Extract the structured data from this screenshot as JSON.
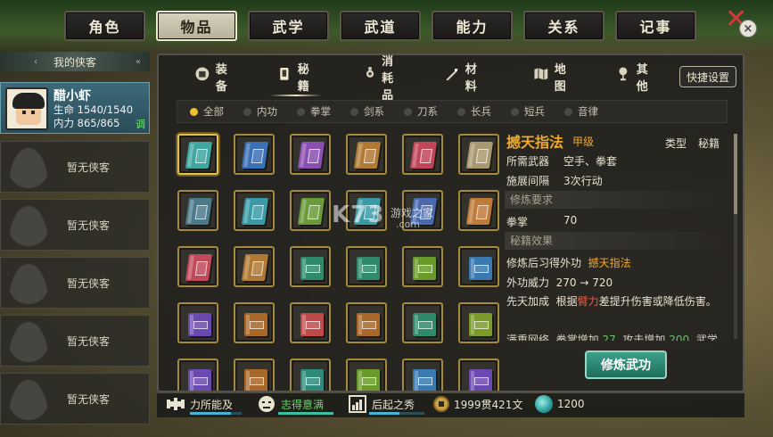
{
  "top_tabs": [
    {
      "label": "角色",
      "active": false
    },
    {
      "label": "物品",
      "active": true
    },
    {
      "label": "武学",
      "active": false
    },
    {
      "label": "武道",
      "active": false
    },
    {
      "label": "能力",
      "active": false
    },
    {
      "label": "关系",
      "active": false
    },
    {
      "label": "记事",
      "active": false
    }
  ],
  "close_icon": "close-icon",
  "roster": {
    "title": "我的侠客",
    "hero": {
      "name": "醋小虾",
      "hp_label": "生命",
      "hp_value": "1540/1540",
      "mp_label": "内力",
      "mp_value": "865/865",
      "tune_label": "调"
    },
    "empty_label": "暂无侠客",
    "empty_slots": 5
  },
  "sub_tabs": [
    {
      "label": "装备",
      "icon": "armor-icon",
      "active": false
    },
    {
      "label": "秘籍",
      "icon": "scroll-icon",
      "active": true
    },
    {
      "label": "消耗品",
      "icon": "potion-icon",
      "active": false
    },
    {
      "label": "材料",
      "icon": "sword-material-icon",
      "active": false
    },
    {
      "label": "地图",
      "icon": "map-icon",
      "active": false
    },
    {
      "label": "其他",
      "icon": "lantern-icon",
      "active": false
    }
  ],
  "quick_settings": "快捷设置",
  "filters": [
    {
      "label": "全部",
      "active": true
    },
    {
      "label": "内功",
      "active": false
    },
    {
      "label": "拳掌",
      "active": false
    },
    {
      "label": "剑系",
      "active": false
    },
    {
      "label": "刀系",
      "active": false
    },
    {
      "label": "长兵",
      "active": false
    },
    {
      "label": "短兵",
      "active": false
    },
    {
      "label": "音律",
      "active": false
    }
  ],
  "books": [
    {
      "color": "#3fa6a0",
      "style": "tilt"
    },
    {
      "color": "#3b6fb6",
      "style": "tilt"
    },
    {
      "color": "#8a4fb0",
      "style": "tilt"
    },
    {
      "color": "#b07a34",
      "style": "tilt"
    },
    {
      "color": "#c0465a",
      "style": "tilt"
    },
    {
      "color": "#a89a70",
      "style": "tilt"
    },
    {
      "color": "#4a7a8a",
      "style": "tilt"
    },
    {
      "color": "#3a9aa6",
      "style": "tilt"
    },
    {
      "color": "#6a9a3a",
      "style": "tilt"
    },
    {
      "color": "#3a9aa6",
      "style": "tilt"
    },
    {
      "color": "#4a6ab0",
      "style": "tilt"
    },
    {
      "color": "#c07a3a",
      "style": "tilt"
    },
    {
      "color": "#c04a5a",
      "style": "tilt"
    },
    {
      "color": "#b07a34",
      "style": "tilt"
    },
    {
      "color": "#2e8a6a",
      "style": "flat"
    },
    {
      "color": "#2e8a6a",
      "style": "flat"
    },
    {
      "color": "#6a9a2a",
      "style": "flat"
    },
    {
      "color": "#3a7ab0",
      "style": "flat"
    },
    {
      "color": "#6a4ab0",
      "style": "flat"
    },
    {
      "color": "#a8682a",
      "style": "flat"
    },
    {
      "color": "#c04a4a",
      "style": "flat"
    },
    {
      "color": "#a8682a",
      "style": "flat"
    },
    {
      "color": "#2e8a6a",
      "style": "flat"
    },
    {
      "color": "#7a9a2a",
      "style": "flat"
    },
    {
      "color": "#6a4ab0",
      "style": "flat"
    },
    {
      "color": "#a8682a",
      "style": "flat"
    },
    {
      "color": "#2e8a7a",
      "style": "flat"
    },
    {
      "color": "#6a9a2a",
      "style": "flat"
    },
    {
      "color": "#3a7ab0",
      "style": "flat"
    },
    {
      "color": "#6a4ab0",
      "style": "flat"
    }
  ],
  "detail": {
    "title": "撼天指法",
    "grade": "甲级",
    "type_label": "类型",
    "type_value": "秘籍",
    "weapon_label": "所需武器",
    "weapon_value": "空手、拳套",
    "interval_label": "施展间隔",
    "interval_value": "3次行动",
    "req_section": "修炼要求",
    "req_label": "拳掌",
    "req_value": "70",
    "effect_section": "秘籍效果",
    "learn_text": "修炼后习得外功",
    "learn_skill": "撼天指法",
    "power_label": "外功威力",
    "power_value": "270 → 720",
    "innate_label": "先天加成",
    "innate_pre": "根据",
    "innate_attr": "臂力",
    "innate_post": "差提升伤害或降低伤害。",
    "cutoff_a": "满重网络",
    "cutoff_b": "拳掌增加",
    "cutoff_c": "27",
    "cutoff_d": "攻击增加",
    "cutoff_e": "200",
    "cutoff_f": "武学"
  },
  "practice_button": "修炼武功",
  "status": {
    "s1": "力所能及",
    "s2": "志得意满",
    "s3": "后起之秀",
    "money": "1999贯421文",
    "jade": "1200"
  },
  "watermark": {
    "logo": "K73",
    "sub": "游戏之家",
    "sub2": ".com"
  }
}
